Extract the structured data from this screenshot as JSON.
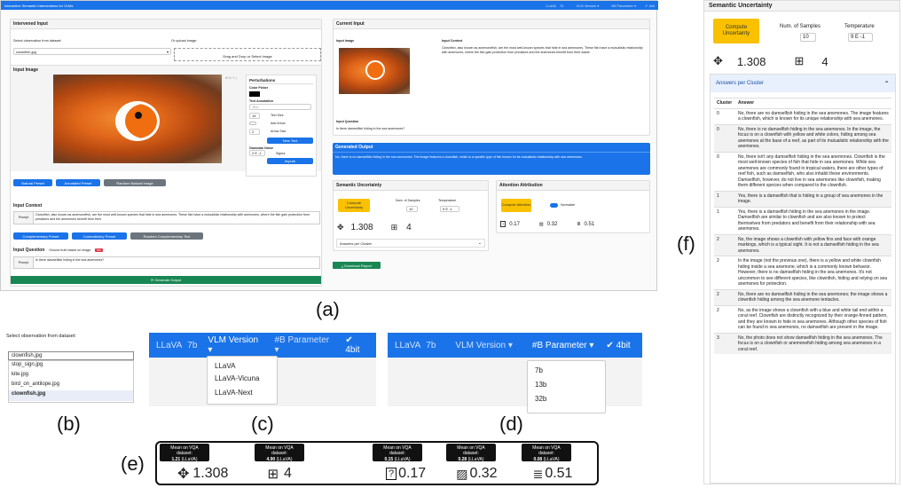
{
  "app": {
    "title": "Interactive Semantic Interventions for VLMs",
    "nav": [
      "LLaVA",
      "7b",
      "VLM Version ▾",
      "#B Parameter ▾",
      "✔ 4bit"
    ]
  },
  "intervened": {
    "header": "Intervened Input",
    "select_label": "Select observation from dataset:",
    "select_value": "clownfish.jpg",
    "upload_label": "Or upload image:",
    "dropzone": "Drag and Drop or Select Image",
    "input_image_title": "Input Image",
    "perturbations_title": "Perturbations",
    "color_picker": "Color Picker",
    "text_annotation": "Text Annotation",
    "text_placeholder": "Text",
    "text_size_value": "16",
    "text_size_label": "Text Size",
    "add_arrow_label": "Add Arrow",
    "arrow_size_value": "2",
    "arrow_size_label": "Arrow Size",
    "new_text": "New Text",
    "gaussian_noise": "Gaussian Noise",
    "sigma_value": "2 E -1",
    "sigma_label": "Sigma",
    "impute": "Impute",
    "presets": [
      "Natural Preset",
      "Annotated Preset",
      "Random Natural Image"
    ],
    "context_title": "Input Context",
    "prompt_label": "Prompt",
    "context_text": "Clownfish, also known as anemonefish, are the most well-known species that hide in sea anemones. These fish have a mutualistic relationship with anemones, where the fish gain protection from predators and the anemones benefit from their",
    "context_buttons": [
      "Complementary Preset",
      "Contradictory Preset",
      "Random Complementary Text"
    ],
    "question_title": "Input Question",
    "ground_truth_label": "Ground truth based on image:",
    "ground_truth_value": "No",
    "question_text": "Is there damselfish hiding in the sea anemones?",
    "generate": "Generate Output"
  },
  "current": {
    "header": "Current Input",
    "image_label": "Input Image",
    "context_label": "Input Context",
    "context_text": "Clownfish, also known as anemonefish, are the most well-known species that hide in sea anemones. These fish have a mutualistic relationship with anemones, where the fish gain protection from predators and the anemones benefit from their waste.",
    "question_label": "Input Question",
    "question_text": "Is there damselfish hiding in the sea anemones?"
  },
  "generated": {
    "header": "Generated Output",
    "text": "No, there is no damselfish hiding in the sea anemones. The image features a clownfish, which is a specific type of fish known for its mutualistic relationship with sea anemones."
  },
  "semantic": {
    "header": "Semantic Uncertainty",
    "compute": "Compute Uncertainty",
    "num_samples_label": "Num. of Samples",
    "num_samples": "10",
    "temperature_label": "Temperature",
    "temperature": "9 E -1",
    "uncertainty": "1.308",
    "clusters": "4",
    "answers_per_cluster": "Answers per Cluster"
  },
  "attention": {
    "header": "Attention Attribution",
    "compute": "Compute Attention",
    "normalize": "Normalize",
    "q": "0.17",
    "img": "0.32",
    "ctx": "0.51"
  },
  "download": "Download Report",
  "labels": {
    "a": "(a)",
    "b": "(b)",
    "c": "(c)",
    "d": "(d)",
    "e": "(e)",
    "f": "(f)"
  },
  "panel_b": {
    "label": "Select observation from dataset:",
    "value": "clownfish.jpg",
    "options": [
      "stop_sign.jpg",
      "kite.jpg",
      "bird_on_antilope.jpg",
      "clownfish.jpg"
    ]
  },
  "panel_c": {
    "nav": [
      "LLaVA",
      "7b",
      "VLM Version ▾",
      "#B Parameter ▾",
      "✔ 4bit"
    ],
    "options": [
      "LLaVA",
      "LLaVA-Vicuna",
      "LLaVA-Next"
    ]
  },
  "panel_d": {
    "nav": [
      "LLaVA",
      "7b",
      "VLM Version ▾",
      "#B Parameter ▾",
      "✔ 4bit"
    ],
    "options": [
      "7b",
      "13b",
      "32b"
    ]
  },
  "panel_e": {
    "tooltip_title": "Mean on VQA dataset:",
    "tooltips": [
      {
        "value": "1.21",
        "model": "(LLaVA)"
      },
      {
        "value": "4.90",
        "model": "(LLaVA)"
      },
      {
        "value": "0.15",
        "model": "(LLaVA)"
      },
      {
        "value": "0.28",
        "model": "(LLaVA)"
      },
      {
        "value": "0.08",
        "model": "(LLaVA)"
      }
    ],
    "uncertainty": "1.308",
    "clusters": "4",
    "q": "0.17",
    "img": "0.32",
    "ctx": "0.51"
  },
  "panel_f": {
    "header": "Semantic Uncertainty",
    "compute": "Compute Uncertainty",
    "num_samples_label": "Num. of Samples",
    "num_samples": "10",
    "temperature_label": "Temperature",
    "temperature": "9 E -1",
    "uncertainty": "1.308",
    "clusters": "4",
    "answers_header": "Answers per Cluster",
    "col_cluster": "Cluster",
    "col_answer": "Answer",
    "rows": [
      {
        "c": "0",
        "a": "No, there are no damselfish hiding in the sea anemones. The image features a clownfish, which is known for its unique relationship with sea anemones."
      },
      {
        "c": "0",
        "a": "No, there is no damselfish hiding in the sea anemones. In the image, the focus is on a clownfish with yellow and white colors, hiding among sea anemones at the base of a reef, as part of its mutualistic relationship with the anemones."
      },
      {
        "c": "0",
        "a": "No, there isn't any damselfish hiding in the sea anemones. Clownfish is the most well-known species of fish that hide in sea anemones. While sea anemones are commonly found in tropical waters, there are other types of reef fish, such as damselfish, who also inhabit these environments. Damselfish, however, do not live in sea anemones like clownfish, making them different species when compared to the clownfish."
      },
      {
        "c": "1",
        "a": "Yes, there is a damselfish that is hiding in a group of sea anemones in the image."
      },
      {
        "c": "1",
        "a": "Yes, there is a damselfish hiding in the sea anemones in the image. Damselfish are similar to clownfish and are also known to protect themselves from predators and benefit from their relationship with sea anemones."
      },
      {
        "c": "2",
        "a": "No, the image shows a clownfish with yellow fins and face with orange markings, which is a typical sight. It is not a damselfish hiding in the sea anemones."
      },
      {
        "c": "2",
        "a": "In the image (not the previous one), there is a yellow and white clownfish hiding inside a sea anemone, which is a commonly known behavior. However, there is no damselfish hiding in the sea anemones. It's not uncommon to see different species, like clownfish, hiding and relying on sea anemones for protection."
      },
      {
        "c": "2",
        "a": "No, there are no damselfish hiding in the sea anemones; the image shows a clownfish hiding among the sea anemone tentacles."
      },
      {
        "c": "2",
        "a": "No, as the image shows a clownfish with a blue and white tail end within a coral reef. Clownfish are distinctly recognized by their orange-finned pattern, and they are known to hide in sea anemones. Although other species of fish can be found in sea anemones, no damselfish are present in the image."
      },
      {
        "c": "3",
        "a": "No, the photo does not show damselfish hiding in the sea anemones. The focus is on a clownfish or anemonefish hiding among sea anemones in a coral reef."
      }
    ]
  }
}
